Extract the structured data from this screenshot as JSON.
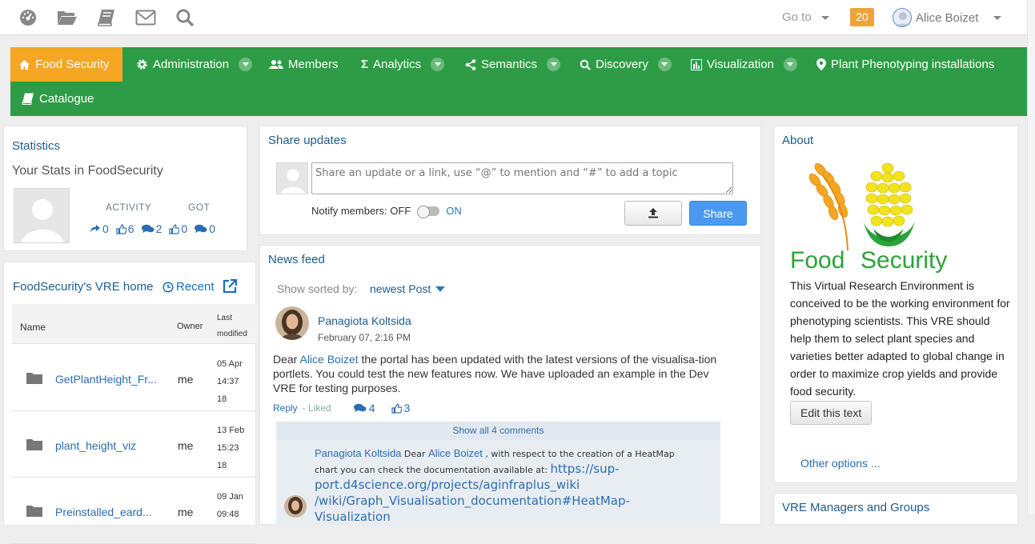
{
  "topbar": {
    "icons": [
      "dashboard-icon",
      "folder-open-icon",
      "book-icon",
      "mail-icon",
      "search-icon"
    ],
    "goto_label": "Go to",
    "notification_count": "20",
    "user_name": "Alice Boizet"
  },
  "nav": {
    "items": [
      {
        "label": "Food Security",
        "icon": "home-icon",
        "active": true
      },
      {
        "label": "Administration",
        "icon": "gear-icon",
        "dropdown": true
      },
      {
        "label": "Members",
        "icon": "users-icon"
      },
      {
        "label": "Analytics",
        "icon": "sigma-icon",
        "dropdown": true
      },
      {
        "label": "Semantics",
        "icon": "share-icon",
        "dropdown": true
      },
      {
        "label": "Discovery",
        "icon": "search-icon",
        "dropdown": true
      },
      {
        "label": "Visualization",
        "icon": "bar-chart-icon",
        "dropdown": true
      },
      {
        "label": "Plant Phenotyping installations",
        "icon": "map-marker-icon"
      },
      {
        "label": "Catalogue",
        "icon": "book-icon"
      }
    ],
    "colors": {
      "bar": "#2e9c46",
      "active": "#f5a623"
    }
  },
  "statistics": {
    "title": "Statistics",
    "subtitle": "Your Stats in FoodSecurity",
    "activity_label": "ACTIVITY",
    "got_label": "GOT",
    "activity": {
      "shares": "0",
      "likes": "6",
      "comments": "2"
    },
    "got": {
      "likes": "0",
      "comments": "0"
    }
  },
  "vre_home": {
    "title": "FoodSecurity's VRE home",
    "recent_label": "Recent",
    "columns": {
      "name": "Name",
      "owner": "Owner",
      "modified_1": "Last",
      "modified_2": "modified"
    },
    "files": [
      {
        "name": "GetPlantHeight_Fr...",
        "owner": "me",
        "d1": "05 Apr",
        "d2": "14:37",
        "d3": "18"
      },
      {
        "name": "plant_height_viz",
        "owner": "me",
        "d1": "13 Feb",
        "d2": "15:23",
        "d3": "18"
      },
      {
        "name": "Preinstalled_eard...",
        "owner": "me",
        "d1": "09 Jan",
        "d2": "09:48",
        "d3": ""
      }
    ]
  },
  "share": {
    "title": "Share updates",
    "placeholder": "Share an update or a link, use “@” to mention and “#” to add a topic",
    "notify_label": "Notify members:",
    "off_label": "OFF",
    "on_label": "ON",
    "share_label": "Share"
  },
  "feed": {
    "title": "News feed",
    "sort_label": "Show sorted by:",
    "sort_value": "newest Post",
    "post": {
      "author": "Panagiota Koltsida",
      "date": "February 07, 2:16 PM",
      "text_pre": "Dear",
      "mention": "Alice Boizet",
      "text_post": " the portal has been updated with the latest versions of the visualisa-tion portlets. You could test the new features now. We have uploaded an example in the Dev VRE for testing purposes.",
      "reply_label": "Reply",
      "liked_label": "Liked",
      "comment_count": "4",
      "like_count": "3",
      "show_all": "Show all 4 comments",
      "comment": {
        "author": "Panagiota Koltsida",
        "pre": "Dear",
        "mention": "Alice Boizet",
        "text": ", with respect to the creation of a HeatMap chart you can check the documentation available at:",
        "link": "https://sup-port.d4science.org/projects/aginfraplus_wiki /wiki/Graph_Visualisation_documentation#HeatMap-Visualization"
      }
    }
  },
  "about": {
    "title": "About",
    "logo_text_1": "Food",
    "logo_text_2": "Security",
    "text": "This Virtual Research Environment is conceived to be the working environment for phenotyping scientists. This VRE should help them to select plant species and varieties better adapted to global change in order to maximize crop yields and provide food security.",
    "edit_label": "Edit this text",
    "other_options": "Other options ..."
  },
  "managers": {
    "title": "VRE Managers and Groups"
  }
}
